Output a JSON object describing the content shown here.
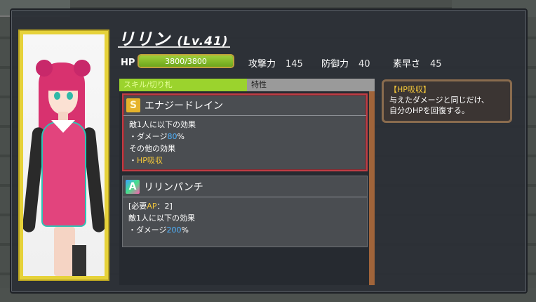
{
  "character": {
    "name": "リリン",
    "level": "(Lv.41)"
  },
  "hp": {
    "label": "HP",
    "text": "3800/3800",
    "ratio": 1.0
  },
  "stats": [
    {
      "label": "攻撃力",
      "value": "145"
    },
    {
      "label": "防御力",
      "value": "40"
    },
    {
      "label": "素早さ",
      "value": "45"
    }
  ],
  "tabs": {
    "skill": "スキル/切り札",
    "trait": "特性"
  },
  "skills": [
    {
      "badge": "S",
      "name": "エナジードレイン",
      "line1": "敵1人に以下の効果",
      "line2_prefix": "・ダメージ",
      "line2_value": "80",
      "line2_suffix": "%",
      "line3": "その他の効果",
      "line4_prefix": "・",
      "line4_value": "HP吸収"
    },
    {
      "badge": "A",
      "name": "リリンパンチ",
      "line1_prefix": "[必要",
      "line1_value": "AP",
      "line1_suffix": "：2]",
      "line2": "敵1人に以下の効果",
      "line3_prefix": "・ダメージ",
      "line3_value": "200",
      "line3_suffix": "%"
    }
  ],
  "tooltip": {
    "title": "【HP吸収】",
    "line1": "与えたダメージと同じだけ、",
    "line2": "自分のHPを回復する。"
  },
  "colors": {
    "skill_tab": "#9bd32d",
    "hp_fill": "#7fb82a",
    "highlight_blue": "#4fb3ff",
    "highlight_yellow": "#f2c63a",
    "selection": "#c03c44"
  }
}
